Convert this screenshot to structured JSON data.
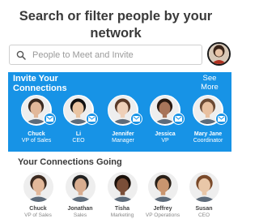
{
  "header": {
    "title": "Search or filter people by your network"
  },
  "search": {
    "placeholder": "People to Meet and Invite",
    "value": ""
  },
  "invite": {
    "title": "Invite Your Connections",
    "see_more": "See More",
    "people": [
      {
        "name": "Chuck",
        "role": "VP of Sales",
        "skin": "#e2b89a",
        "hair": "#3b2a20"
      },
      {
        "name": "Li",
        "role": "CEO",
        "skin": "#e9c4a2",
        "hair": "#111111"
      },
      {
        "name": "Jennifer",
        "role": "Manager",
        "skin": "#efd0b8",
        "hair": "#5a3a28"
      },
      {
        "name": "Jessica",
        "role": "VP",
        "skin": "#a8755a",
        "hair": "#2a1a12"
      },
      {
        "name": "Mary Jane",
        "role": "Coordinator",
        "skin": "#e8c0a0",
        "hair": "#6b4a34"
      }
    ]
  },
  "going": {
    "title": "Your Connections Going",
    "people": [
      {
        "name": "Chuck",
        "role": "VP of Sales",
        "skin": "#e2b89a",
        "hair": "#3b2a20"
      },
      {
        "name": "Jonathan",
        "role": "Sales",
        "skin": "#d8ad90",
        "hair": "#222222"
      },
      {
        "name": "Tisha",
        "role": "Marketing",
        "skin": "#7a4e38",
        "hair": "#1a100a"
      },
      {
        "name": "Jeffrey",
        "role": "VP Operations",
        "skin": "#c9956f",
        "hair": "#2a2018"
      },
      {
        "name": "Susan",
        "role": "CEO",
        "skin": "#e9c7a8",
        "hair": "#7a4a2a"
      }
    ]
  },
  "colors": {
    "accent": "#1793e6",
    "title": "#3a3a3a"
  },
  "icons": {
    "search": "search-icon",
    "mail": "mail-icon"
  }
}
